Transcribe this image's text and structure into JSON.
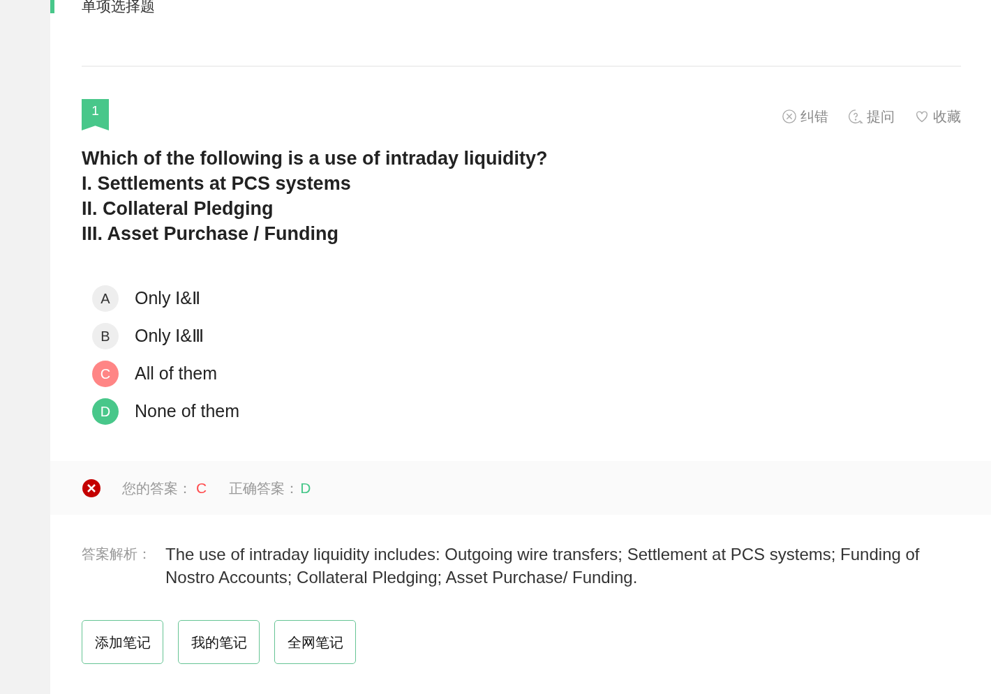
{
  "section_title": "单项选择题",
  "question": {
    "number": "1",
    "actions": [
      {
        "kind": "report",
        "label": "纠错"
      },
      {
        "kind": "ask",
        "label": "提问"
      },
      {
        "kind": "favorite",
        "label": "收藏"
      }
    ],
    "stem": [
      "Which of the following is a use of intraday liquidity?",
      "I. Settlements at PCS systems",
      "II. Collateral Pledging",
      "III. Asset Purchase / Funding"
    ],
    "options": [
      {
        "letter": "A",
        "text": "Only Ⅰ&Ⅱ",
        "selected": false,
        "correct": false
      },
      {
        "letter": "B",
        "text": "Only Ⅰ&Ⅲ",
        "selected": false,
        "correct": false
      },
      {
        "letter": "C",
        "text": "All of them",
        "selected": true,
        "correct": false
      },
      {
        "letter": "D",
        "text": "None of them",
        "selected": false,
        "correct": true
      }
    ]
  },
  "result": {
    "is_correct": false,
    "your_answer_label": "您的答案：",
    "your_answer": "C",
    "correct_answer_label": "正确答案：",
    "correct_answer": "D"
  },
  "explanation": {
    "label": "答案解析：",
    "text": "The use of intraday liquidity includes: Outgoing wire transfers; Settlement at PCS systems; Funding of Nostro Accounts; Collateral Pledging; Asset Purchase/ Funding."
  },
  "note_buttons": [
    "添加笔记",
    "我的笔记",
    "全网笔记"
  ]
}
